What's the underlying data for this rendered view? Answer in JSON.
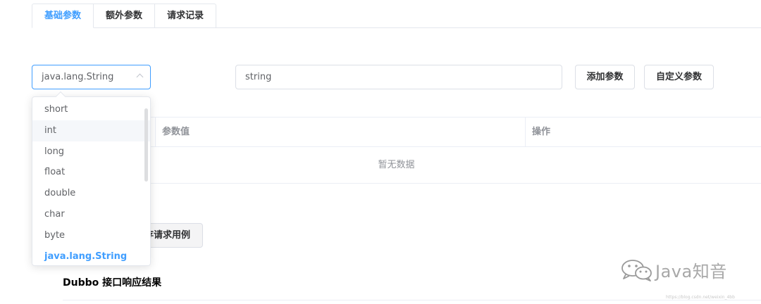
{
  "tabs": [
    {
      "label": "基础参数",
      "active": true
    },
    {
      "label": "额外参数",
      "active": false
    },
    {
      "label": "请求记录",
      "active": false
    }
  ],
  "param_type_select": {
    "value": "java.lang.String",
    "icon": "chevron-up-icon",
    "options": [
      "short",
      "int",
      "long",
      "float",
      "double",
      "char",
      "byte",
      "java.lang.String"
    ],
    "hover_option": "int"
  },
  "param_value_input": {
    "value": "string"
  },
  "buttons": {
    "add_param": "添加参数",
    "custom_param": "自定义参数",
    "save_example": "存请求用例"
  },
  "table": {
    "columns": [
      "参数值",
      "操作"
    ],
    "empty_text": "暂无数据"
  },
  "response": {
    "title": "Dubbo 接口响应结果"
  },
  "watermark": {
    "text": "Java知音",
    "icon": "wechat-icon",
    "url": "https://blog.csdn.net/weixin_4bb"
  },
  "colors": {
    "accent": "#409eff",
    "border": "#dcdfe6",
    "text": "#303133",
    "muted": "#909399",
    "hover_bg": "#f5f7fa"
  }
}
